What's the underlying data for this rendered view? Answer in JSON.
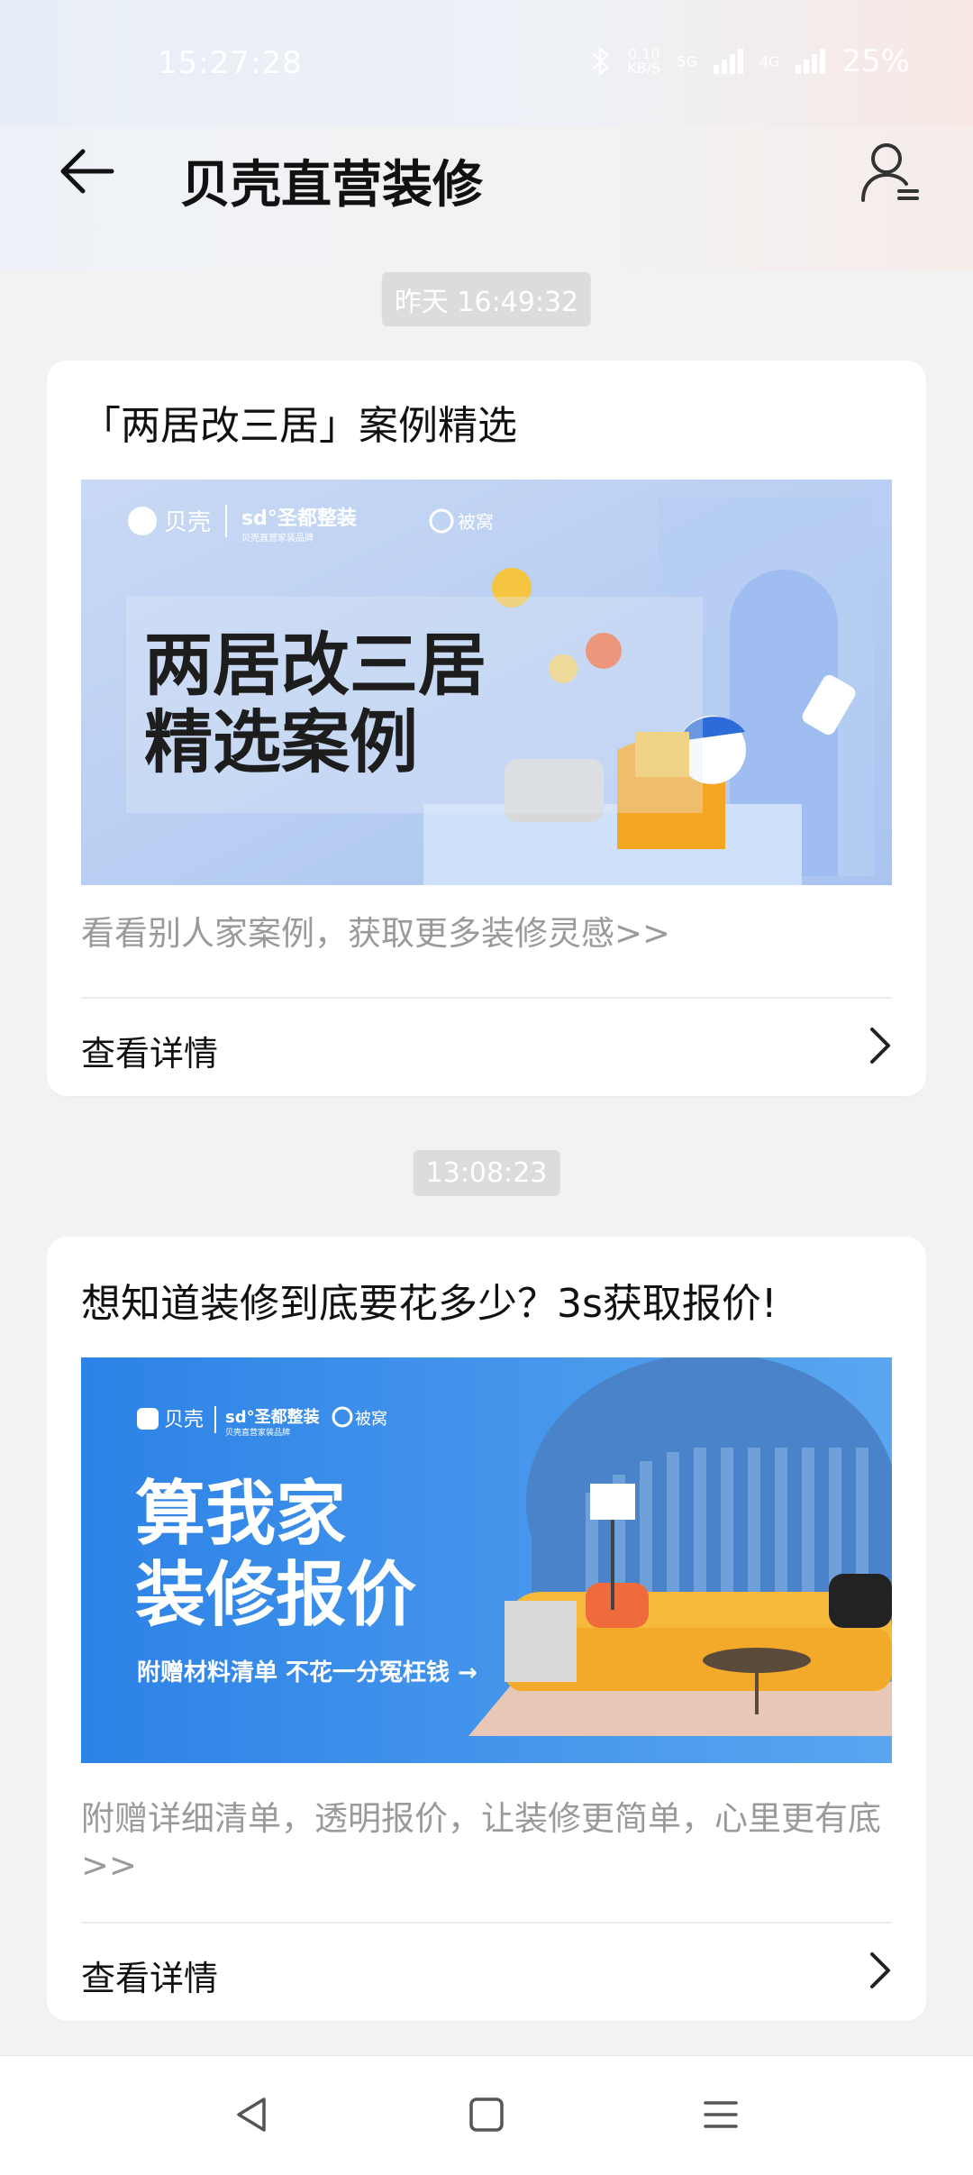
{
  "status_bar": {
    "time": "15:27:28",
    "network_speed_value": "0.10",
    "network_speed_unit": "KB/S",
    "net_5g": "5G",
    "net_4g": "4G",
    "battery": "25%"
  },
  "header": {
    "title": "贝壳直营装修",
    "icons": [
      "back-arrow-icon",
      "user-icon"
    ]
  },
  "messages": [
    {
      "timestamp": "昨天 16:49:32",
      "title": "「两居改三居」案例精选",
      "banner": {
        "brand_beike": "贝壳",
        "brand_sd": "sd°圣都整装",
        "brand_sd_sub": "贝壳直营家装品牌",
        "brand_beian": "被窝",
        "headline_line1": "两居改三居",
        "headline_line2": "精选案例"
      },
      "description": "看看别人家案例，获取更多装修灵感>>",
      "detail_label": "查看详情"
    },
    {
      "timestamp": "13:08:23",
      "title": "想知道装修到底要花多少？3s获取报价!",
      "banner": {
        "brand_beike": "贝壳",
        "brand_sd": "sd°圣都整装",
        "brand_sd_sub": "贝壳直营家装品牌",
        "brand_beian": "被窝",
        "headline_line1": "算我家",
        "headline_line2": "装修报价",
        "subline": "附赠材料清单 不花一分冤枉钱 →"
      },
      "description": "附赠详细清单，透明报价，让装修更简单，心里更有底>>",
      "detail_label": "查看详情"
    }
  ],
  "nav_bar": {
    "icons": [
      "back-triangle-icon",
      "home-square-icon",
      "menu-lines-icon"
    ]
  }
}
